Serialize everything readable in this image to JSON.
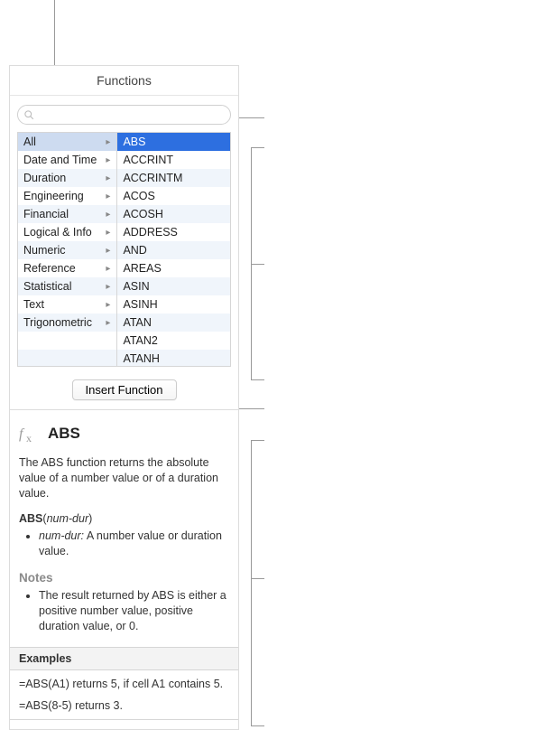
{
  "header": {
    "title": "Functions"
  },
  "search": {
    "placeholder": ""
  },
  "categories": [
    "All",
    "Date and Time",
    "Duration",
    "Engineering",
    "Financial",
    "Logical & Info",
    "Numeric",
    "Reference",
    "Statistical",
    "Text",
    "Trigonometric"
  ],
  "functions": [
    "ABS",
    "ACCRINT",
    "ACCRINTM",
    "ACOS",
    "ACOSH",
    "ADDRESS",
    "AND",
    "AREAS",
    "ASIN",
    "ASINH",
    "ATAN",
    "ATAN2",
    "ATANH"
  ],
  "insert": {
    "label": "Insert Function"
  },
  "detail": {
    "name": "ABS",
    "description": "The ABS function returns the absolute value of a number value or of a duration value.",
    "syntax_name": "ABS",
    "syntax_arg": "num-dur",
    "param_name": "num-dur:",
    "param_desc": " A number value or duration value.",
    "notes_heading": "Notes",
    "note1": "The result returned by ABS is either a positive number value, positive duration value, or 0.",
    "examples_heading": "Examples",
    "example1": "=ABS(A1) returns 5, if cell A1 contains 5.",
    "example2": "=ABS(8-5) returns 3."
  }
}
